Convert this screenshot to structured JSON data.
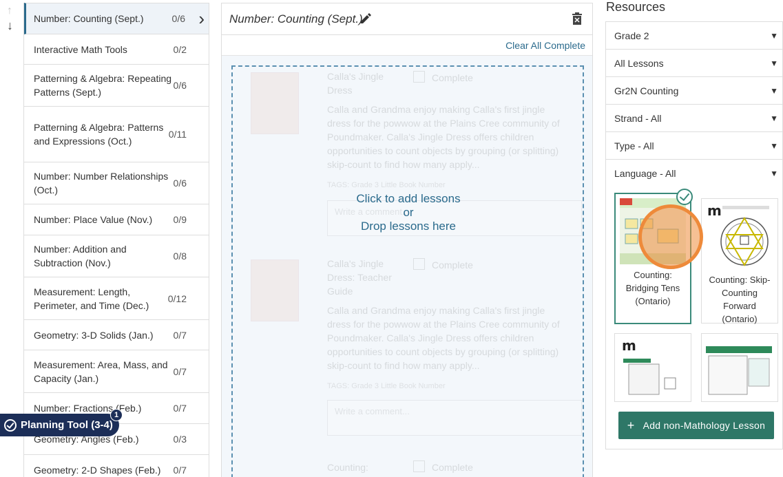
{
  "units": [
    {
      "label": "Number: Counting (Sept.)",
      "count": "0/6",
      "active": true
    },
    {
      "label": "Interactive Math Tools",
      "count": "0/2"
    },
    {
      "label": "Patterning & Algebra: Repeating Patterns (Sept.)",
      "count": "0/6"
    },
    {
      "label": "Patterning & Algebra: Patterns and Expressions (Oct.)",
      "count": "0/11"
    },
    {
      "label": "Number: Number Relationships (Oct.)",
      "count": "0/6"
    },
    {
      "label": "Number: Place Value (Nov.)",
      "count": "0/9"
    },
    {
      "label": "Number: Addition and Subtraction (Nov.)",
      "count": "0/8"
    },
    {
      "label": "Measurement: Length, Perimeter, and Time (Dec.)",
      "count": "0/12"
    },
    {
      "label": "Geometry: 3-D Solids (Jan.)",
      "count": "0/7"
    },
    {
      "label": "Measurement: Area, Mass, and Capacity (Jan.)",
      "count": "0/7"
    },
    {
      "label": "Number: Fractions (Feb.)",
      "count": "0/7"
    },
    {
      "label": "Geometry: Angles (Feb.)",
      "count": "0/3"
    },
    {
      "label": "Geometry: 2-D Shapes (Feb.)",
      "count": "0/7"
    }
  ],
  "planning_tool": {
    "label": "Planning Tool (3-4)",
    "badge": "1"
  },
  "center": {
    "title": "Number: Counting (Sept.)",
    "clear_all": "Clear All Complete",
    "drop_line1": "Click to add lessons",
    "drop_line2": "or",
    "drop_line3": "Drop lessons here",
    "lessons": [
      {
        "name": "Calla's Jingle Dress",
        "complete": "Complete",
        "desc": "Calla and Grandma enjoy making Calla's first jingle dress for the powwow at the Plains Cree community of Poundmaker. Calla's Jingle Dress offers children opportunities to count objects by grouping (or splitting) skip-count to find how many apply...",
        "tags_label": "TAGS:",
        "tags": "Grade 3   Little Book   Number",
        "comment_placeholder": "Write a comment..."
      },
      {
        "name": "Calla's Jingle Dress: Teacher Guide",
        "complete": "Complete",
        "desc": "Calla and Grandma enjoy making Calla's first jingle dress for the powwow at the Plains Cree community of Poundmaker. Calla's Jingle Dress offers children opportunities to count objects by grouping (or splitting) skip-count to find how many apply...",
        "tags_label": "TAGS:",
        "tags": "Grade 3   Little Book   Number",
        "comment_placeholder": "Write a comment..."
      },
      {
        "name": "Counting:",
        "complete": "Complete"
      }
    ]
  },
  "resources": {
    "title": "Resources",
    "filters": [
      "Grade 2",
      "All Lessons",
      "Gr2N Counting",
      "Strand - All",
      "Type - All",
      "Language - All"
    ],
    "cards": [
      {
        "caption": "Counting: Bridging Tens (Ontario)",
        "selected": true
      },
      {
        "caption": "Counting: Skip-Counting Forward (Ontario)",
        "selected": false
      },
      {
        "caption": "",
        "selected": false
      },
      {
        "caption": "",
        "selected": false
      }
    ],
    "add_button": "Add non-Mathology Lesson"
  },
  "colors": {
    "accent": "#2a6a8c",
    "green": "#2e7767",
    "navy": "#1c2e58",
    "cursor": "#ee8a3a"
  }
}
